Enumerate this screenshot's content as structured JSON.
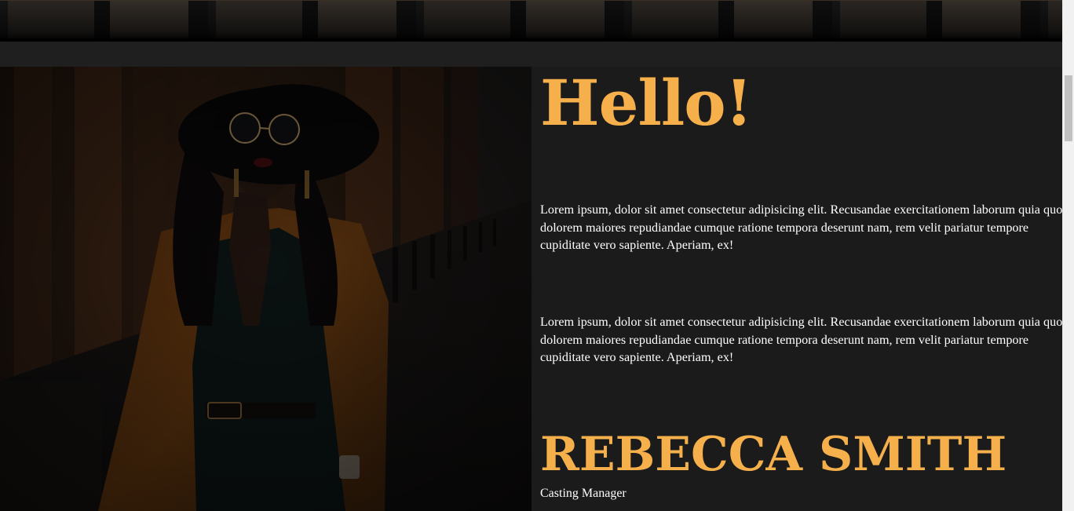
{
  "hero": {
    "greeting": "Hello!",
    "paragraphs": [
      "Lorem ipsum, dolor sit amet consectetur adipisicing elit. Recusandae exercitationem laborum quia quo dolorem maiores repudiandae cumque ratione tempora deserunt nam, rem velit pariatur tempore cupiditate vero sapiente. Aperiam, ex!",
      "Lorem ipsum, dolor sit amet consectetur adipisicing elit. Recusandae exercitationem laborum quia quo dolorem maiores repudiandae cumque ratione tempora deserunt nam, rem velit pariatur tempore cupiditate vero sapiente. Aperiam, ex!"
    ],
    "name": "REBECCA SMITH",
    "role": "Casting Manager"
  },
  "colors": {
    "accent": "#f5b04c",
    "background": "#1b1b1b",
    "text": "#ffffff"
  },
  "images": {
    "portrait": "portrait-photo"
  }
}
